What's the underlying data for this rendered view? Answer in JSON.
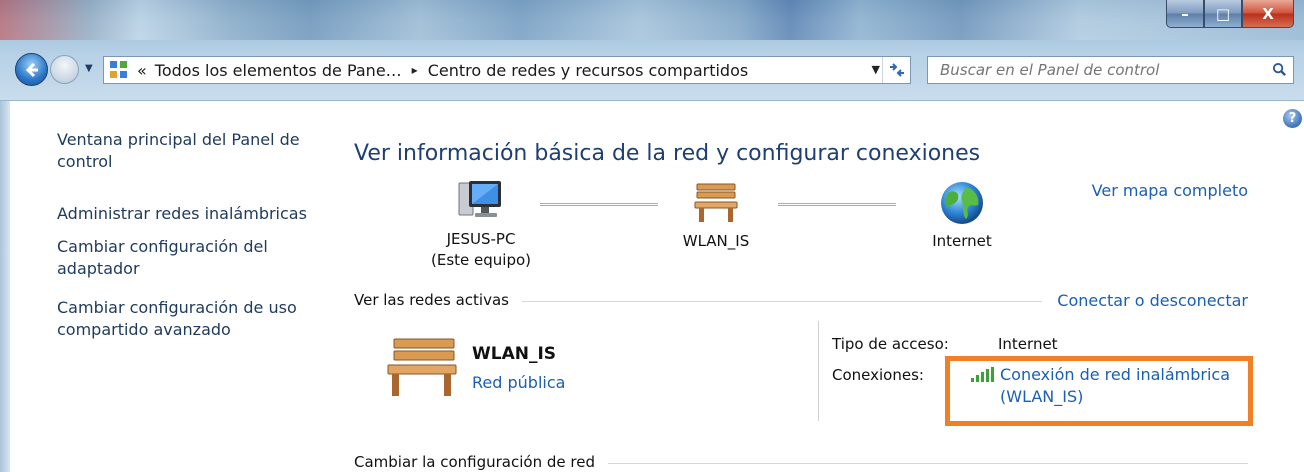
{
  "window": {
    "minimize_label": "–",
    "maximize_label": "□",
    "close_label": "X"
  },
  "address": {
    "breadcrumb_prefix": "«",
    "crumb_1": "Todos los elementos de Pane…",
    "separator": "▸",
    "crumb_2": "Centro de redes y recursos compartidos"
  },
  "search": {
    "placeholder": "Buscar en el Panel de control"
  },
  "sidebar": {
    "items": [
      {
        "label": "Ventana principal del Panel de control"
      },
      {
        "label": "Administrar redes inalámbricas"
      },
      {
        "label": "Cambiar configuración del adaptador"
      },
      {
        "label": "Cambiar configuración de uso compartido avanzado"
      }
    ]
  },
  "main": {
    "title": "Ver información básica de la red y configurar conexiones",
    "map_link": "Ver mapa completo",
    "nodes": [
      {
        "line1": "JESUS-PC",
        "line2": "(Este equipo)",
        "icon": "computer-icon"
      },
      {
        "line1": "WLAN_IS",
        "line2": "",
        "icon": "bench-icon"
      },
      {
        "line1": "Internet",
        "line2": "",
        "icon": "globe-icon"
      }
    ],
    "active_networks_heading": "Ver las redes activas",
    "connect_link": "Conectar o desconectar",
    "network": {
      "name": "WLAN_IS",
      "type": "Red pública"
    },
    "access_type_label": "Tipo de acceso:",
    "access_type_value": "Internet",
    "connections_label": "Conexiones:",
    "connection_link_line1": "Conexión de red inalámbrica",
    "connection_link_line2": "(WLAN_IS)",
    "change_config_heading": "Cambiar la configuración de red"
  },
  "colors": {
    "link": "#1a5fb4",
    "title": "#1d3f73",
    "highlight": "#f17f25"
  }
}
